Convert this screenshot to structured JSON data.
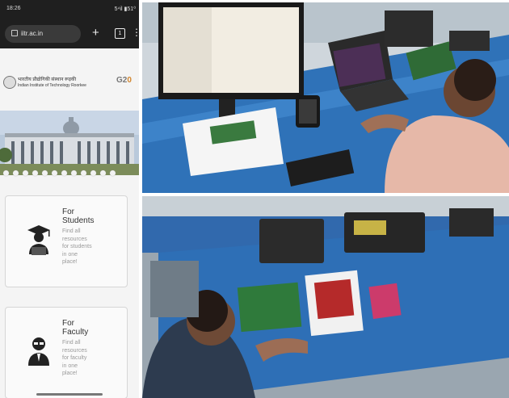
{
  "phone": {
    "status": {
      "time": "18:26",
      "signal": "5⁴il ▮51⁰"
    },
    "url": "iitr.ac.in",
    "plus_label": "+",
    "tabs_label": "1",
    "more_label": "⋮",
    "header": {
      "hindi_name": "भारतीय प्रौद्योगिकी संस्थान रूड़की",
      "english_name": "Indian Institute of Technology Roorkee",
      "g20_logo": "G20"
    },
    "carousel_dots": 12,
    "cards": [
      {
        "title_line1": "For",
        "title_line2": "Students",
        "desc": [
          "Find all",
          "resources",
          "for students",
          "in one",
          "place!"
        ],
        "icon": "student-laptop-icon"
      },
      {
        "title_line1": "For",
        "title_line2": "Faculty",
        "desc": [
          "Find all",
          "resources",
          "for faculty",
          "in one",
          "place!"
        ],
        "icon": "faculty-person-icon"
      }
    ]
  },
  "photos": {
    "top": {
      "subject": "lab-workstation-monitor-laptop-dev-board-photo"
    },
    "bottom": {
      "subject": "lab-bench-fpga-boards-photo"
    }
  }
}
